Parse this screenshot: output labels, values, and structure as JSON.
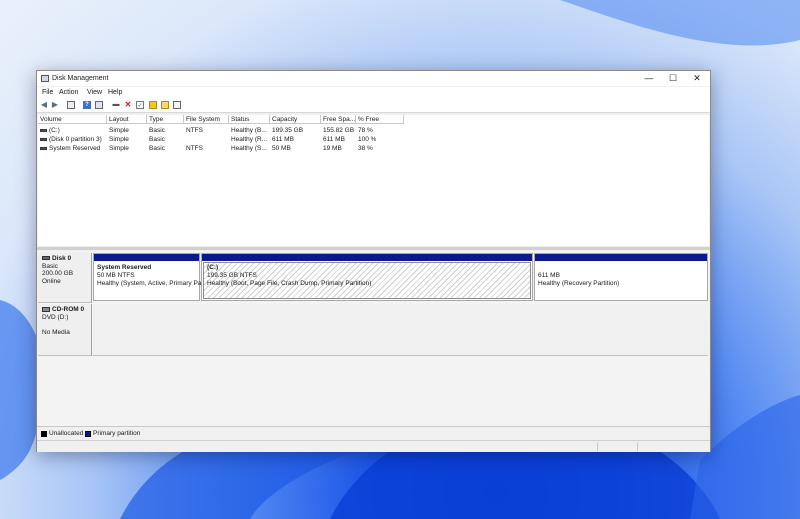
{
  "window": {
    "title": "Disk Management"
  },
  "menu": [
    "File",
    "Action",
    "View",
    "Help"
  ],
  "toolbar_icons": [
    "back-arrow-icon",
    "forward-arrow-icon",
    "console-tree-icon",
    "help-icon",
    "disk-list-icon",
    "connect-disk-icon",
    "delete-icon",
    "check-icon",
    "open-folder-icon",
    "explore-icon",
    "properties-icon"
  ],
  "table": {
    "columns": [
      "Volume",
      "Layout",
      "Type",
      "File System",
      "Status",
      "Capacity",
      "Free Spa...",
      "% Free"
    ],
    "rows": [
      [
        "(C:)",
        "Simple",
        "Basic",
        "NTFS",
        "Healthy (B...",
        "199.35 GB",
        "155.82 GB",
        "78 %"
      ],
      [
        "(Disk 0 partition 3)",
        "Simple",
        "Basic",
        "",
        "Healthy (R...",
        "611 MB",
        "611 MB",
        "100 %"
      ],
      [
        "System Reserved",
        "Simple",
        "Basic",
        "NTFS",
        "Healthy (S...",
        "50 MB",
        "19 MB",
        "38 %"
      ]
    ]
  },
  "disks": [
    {
      "name": "Disk 0",
      "lines": [
        "Basic",
        "200.00 GB",
        "Online"
      ]
    },
    {
      "name": "CD-ROM 0",
      "lines": [
        "DVD (D:)",
        "",
        "No Media"
      ]
    }
  ],
  "partitions": [
    {
      "name": "System Reserved",
      "size": "50 MB NTFS",
      "status": "Healthy (System, Active, Primary Pa"
    },
    {
      "name": "(C:)",
      "size": "199.35 GB NTFS",
      "status": "Healthy (Boot, Page File, Crash Dump, Primary Partition)"
    },
    {
      "name": "",
      "size": "611 MB",
      "status": "Healthy (Recovery Partition)"
    }
  ],
  "legend": [
    {
      "label": "Unallocated",
      "color": "#000000"
    },
    {
      "label": "Primary partition",
      "color": "#0a1a8c"
    }
  ],
  "colors": {
    "partition_bar": "#0a1a8c",
    "accent": "#1a56e8"
  }
}
